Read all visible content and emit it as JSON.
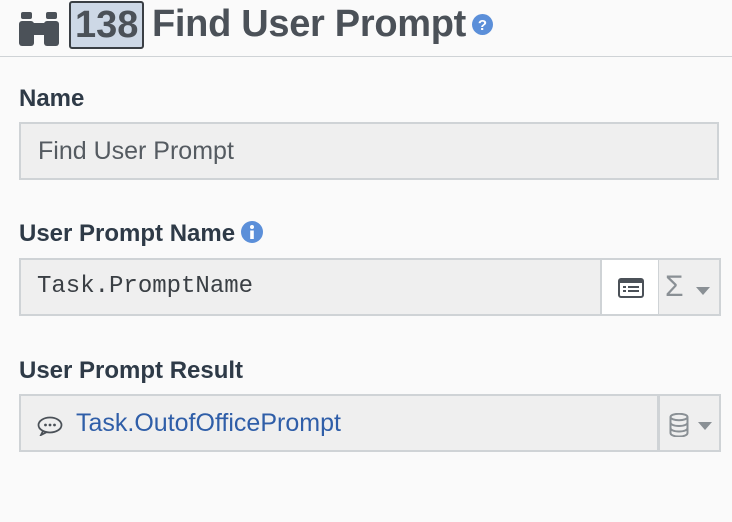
{
  "header": {
    "step_number": "138",
    "title": "Find User Prompt",
    "icon": "binoculars-icon",
    "help_icon": "question-circle-icon"
  },
  "fields": {
    "name": {
      "label": "Name",
      "value": "Find User Prompt"
    },
    "user_prompt_name": {
      "label": "User Prompt Name",
      "value": "Task.PromptName",
      "info_icon": "info-circle-icon",
      "picker_icon": "list-picker-icon",
      "expression_symbol": "Σ"
    },
    "user_prompt_result": {
      "label": "User Prompt Result",
      "value": "Task.OutofOfficePrompt",
      "value_icon": "chat-bubble-icon",
      "storage_icon": "database-icon"
    }
  },
  "colors": {
    "accent_blue": "#2f5ea8",
    "help_blue": "#5b8fd9",
    "text_dark": "#2e3a47",
    "field_bg": "#efefef",
    "border": "#cfd3d6"
  }
}
